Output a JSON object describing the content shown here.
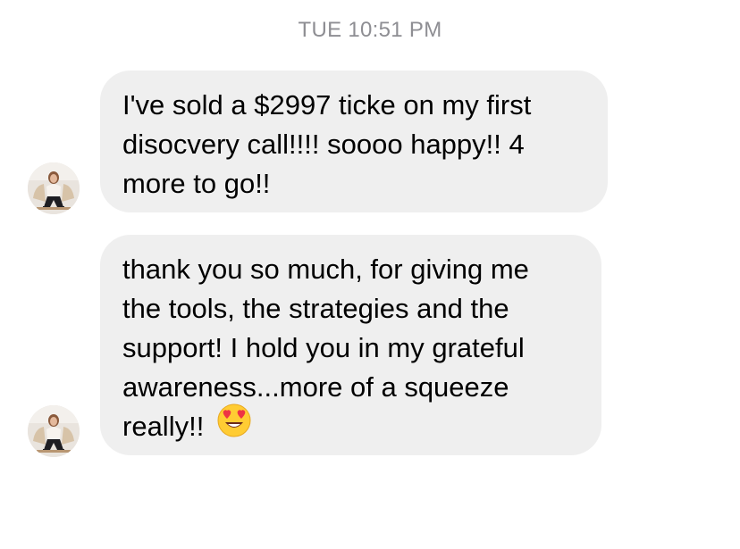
{
  "header": {
    "timestamp": "TUE 10:51 PM"
  },
  "messages": [
    {
      "sender": "contact",
      "avatar_icon": "profile-photo-woman-seated-icon",
      "lines": [
        "I've sold a $2997 ticke on my first",
        "disocvery call!!!! soooo happy!! 4",
        "more to go!!"
      ]
    },
    {
      "sender": "contact",
      "avatar_icon": "profile-photo-woman-seated-icon",
      "lines": [
        "thank you so much, for giving me",
        "the tools, the strategies and the",
        "support! I hold you in my grateful",
        "awareness...more of a squeeze",
        "really!!"
      ],
      "trailing_emoji": "heart-eyes-emoji-icon"
    }
  ],
  "colors": {
    "bubble_background": "#efefef",
    "timestamp_text": "#8e8e93",
    "message_text": "#000000"
  }
}
